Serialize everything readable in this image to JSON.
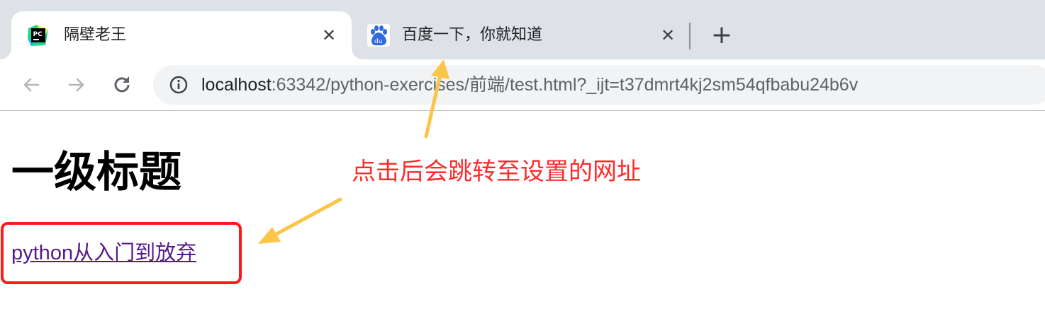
{
  "tabs": [
    {
      "title": "隔壁老王",
      "favicon": "pycharm-logo",
      "active": true,
      "close": "✕"
    },
    {
      "title": "百度一下，你就知道",
      "favicon": "baidu-paw-logo",
      "active": false,
      "close": "✕"
    }
  ],
  "new_tab_label": "+",
  "toolbar": {
    "back_icon": "back-arrow-icon",
    "forward_icon": "forward-arrow-icon",
    "reload_icon": "reload-icon",
    "info_icon": "info-icon",
    "url_host": "localhost",
    "url_rest": ":63342/python-exercises/前端/test.html?_ijt=t37dmrt4kj2sm54qfbabu24b6v"
  },
  "page": {
    "heading": "一级标题",
    "link_text": "python从入门到放弃"
  },
  "annotation": {
    "text": "点击后会跳转至设置的网址"
  },
  "colors": {
    "tabstrip_bg": "#dee1e6",
    "omnibox_bg": "#f1f3f4",
    "link_visited": "#551a8b",
    "annotation_red": "#ff2a2a",
    "box_red": "#ff1a1a",
    "arrow_yellow": "#fbc54a"
  }
}
